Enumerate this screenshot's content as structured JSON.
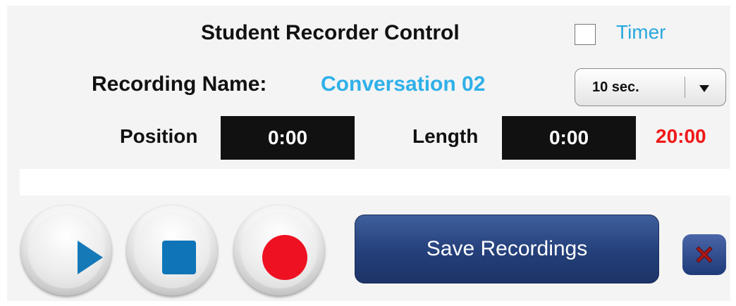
{
  "panel": {
    "title": "Student Recorder Control",
    "timer_label": "Timer",
    "timer_checked": false
  },
  "recording": {
    "label": "Recording Name:",
    "name": "Conversation 02",
    "duration_select": "10 sec."
  },
  "times": {
    "position_label": "Position",
    "position_value": "0:00",
    "length_label": "Length",
    "length_value": "0:00",
    "max_time": "20:00"
  },
  "progress": {
    "fraction": 0.0
  },
  "controls": {
    "play_icon": "play-icon",
    "stop_icon": "stop-icon",
    "record_icon": "record-icon",
    "save_label": "Save Recordings",
    "close_icon": "close-icon"
  },
  "colors": {
    "accent_blue": "#2fb0e8",
    "max_time_red": "#f01818",
    "save_button": "#243f7a",
    "record_red": "#ee1122",
    "play_blue": "#1579b8"
  }
}
